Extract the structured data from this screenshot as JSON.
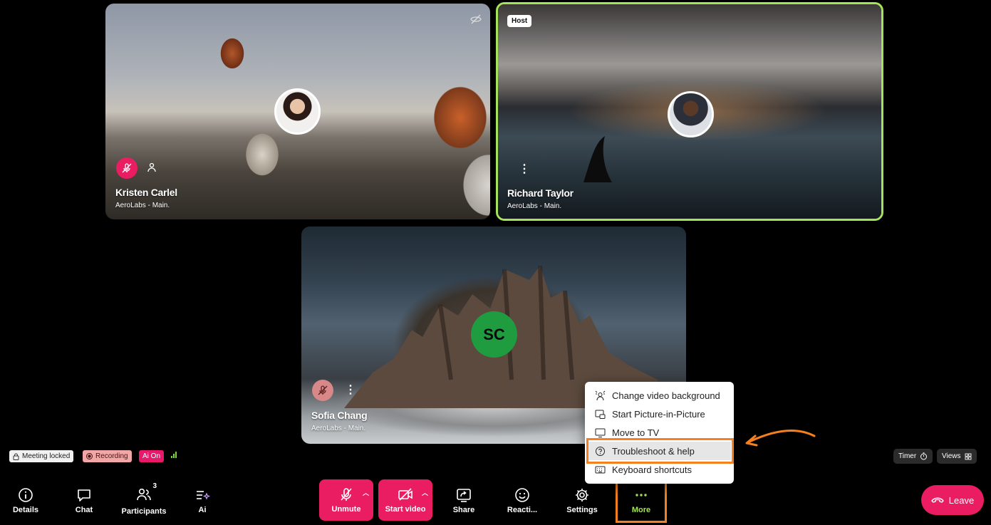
{
  "tiles": {
    "kristen": {
      "name": "Kristen Carlel",
      "org": "AeroLabs - Main."
    },
    "richard": {
      "name": "Richard Taylor",
      "org": "AeroLabs - Main.",
      "badge": "Host"
    },
    "sofia": {
      "name": "Sofia Chang",
      "org": "AeroLabs - Main.",
      "initials": "SC"
    }
  },
  "status": {
    "locked": "Meeting locked",
    "recording": "Recording",
    "ai": "Ai On"
  },
  "right_pills": {
    "timer": "Timer",
    "views": "Views"
  },
  "toolbar": {
    "details": "Details",
    "chat": "Chat",
    "participants": "Participants",
    "participants_count": "3",
    "ai": "Ai",
    "unmute": "Unmute",
    "start_video": "Start video",
    "share": "Share",
    "reactions": "Reacti...",
    "settings": "Settings",
    "more": "More",
    "leave": "Leave"
  },
  "more_menu": {
    "items": [
      {
        "label": "Change video background",
        "icon": "background-icon"
      },
      {
        "label": "Start Picture-in-Picture",
        "icon": "pip-icon"
      },
      {
        "label": "Move to TV",
        "icon": "tv-icon"
      },
      {
        "label": "Troubleshoot & help",
        "icon": "help-icon"
      },
      {
        "label": "Keyboard shortcuts",
        "icon": "keyboard-icon"
      }
    ]
  },
  "colors": {
    "accent": "#ea1d62",
    "active_speaker_border": "#a6e35a",
    "annotation": "#f4801f",
    "avatar_bg": "#1f9c3f"
  }
}
